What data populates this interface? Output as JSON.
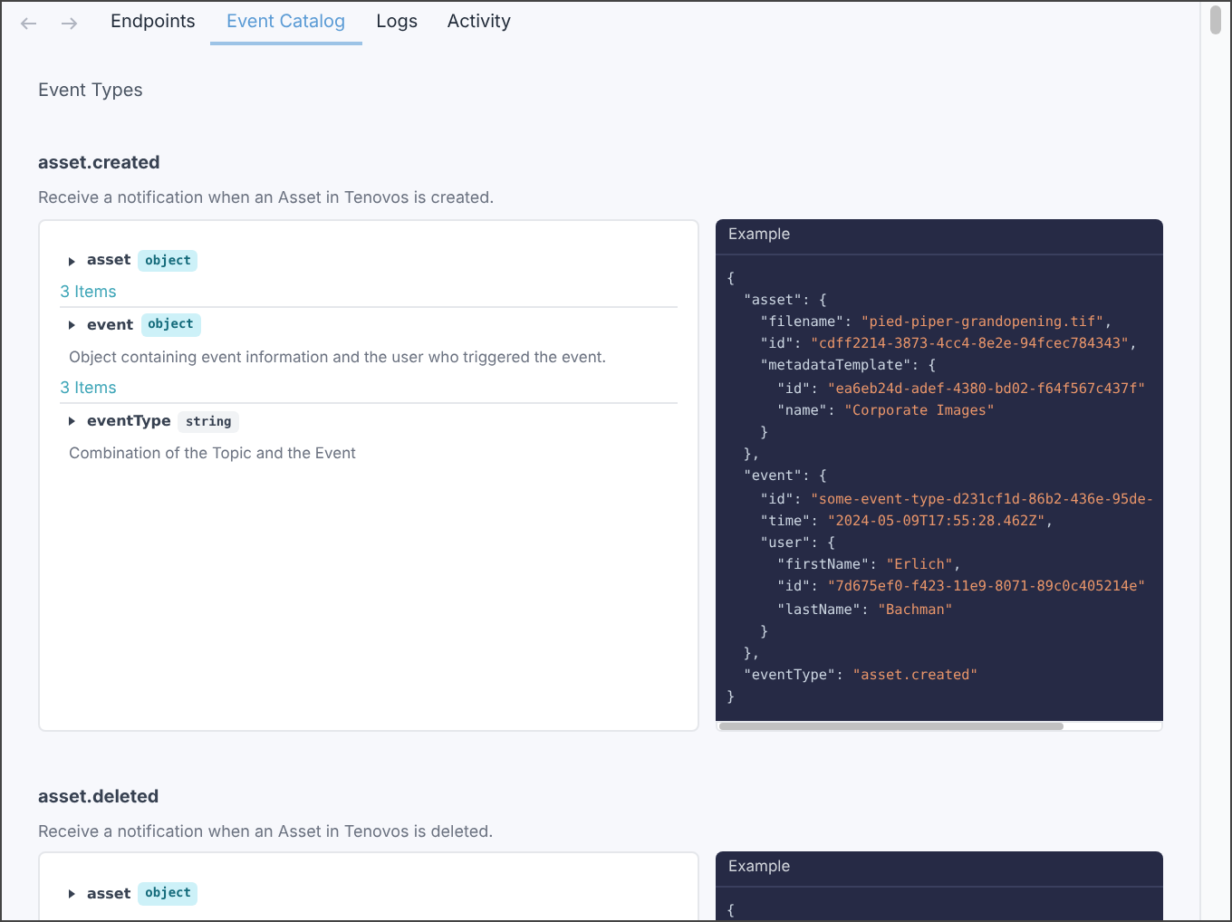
{
  "nav": {
    "tabs": [
      {
        "label": "Endpoints",
        "selected": false
      },
      {
        "label": "Event Catalog",
        "selected": true
      },
      {
        "label": "Logs",
        "selected": false
      },
      {
        "label": "Activity",
        "selected": false
      }
    ]
  },
  "heading": "Event Types",
  "events": [
    {
      "name": "asset.created",
      "description": "Receive a notification when an Asset in Tenovos is created.",
      "properties": [
        {
          "name": "asset",
          "type": "object",
          "items": "3 Items"
        },
        {
          "name": "event",
          "type": "object",
          "description": "Object containing event information and the user who triggered the event.",
          "items": "3 Items"
        },
        {
          "name": "eventType",
          "type": "string",
          "description": "Combination of the Topic and the Event"
        }
      ],
      "example": {
        "title": "Example",
        "lines": [
          "{",
          "  \"asset\": {",
          "    \"filename\": \"pied-piper-grandopening.tif\",",
          "    \"id\": \"cdff2214-3873-4cc4-8e2e-94fcec784343\",",
          "    \"metadataTemplate\": {",
          "      \"id\": \"ea6eb24d-adef-4380-bd02-f64f567c437f\"",
          "      \"name\": \"Corporate Images\"",
          "    }",
          "  },",
          "  \"event\": {",
          "    \"id\": \"some-event-type-d231cf1d-86b2-436e-95de-",
          "    \"time\": \"2024-05-09T17:55:28.462Z\",",
          "    \"user\": {",
          "      \"firstName\": \"Erlich\",",
          "      \"id\": \"7d675ef0-f423-11e9-8071-89c0c405214e\"",
          "      \"lastName\": \"Bachman\"",
          "    }",
          "  },",
          "  \"eventType\": \"asset.created\"",
          "}"
        ]
      }
    },
    {
      "name": "asset.deleted",
      "description": "Receive a notification when an Asset in Tenovos is deleted.",
      "properties": [
        {
          "name": "asset",
          "type": "object"
        }
      ],
      "example": {
        "title": "Example",
        "lines": [
          "{"
        ]
      }
    }
  ]
}
